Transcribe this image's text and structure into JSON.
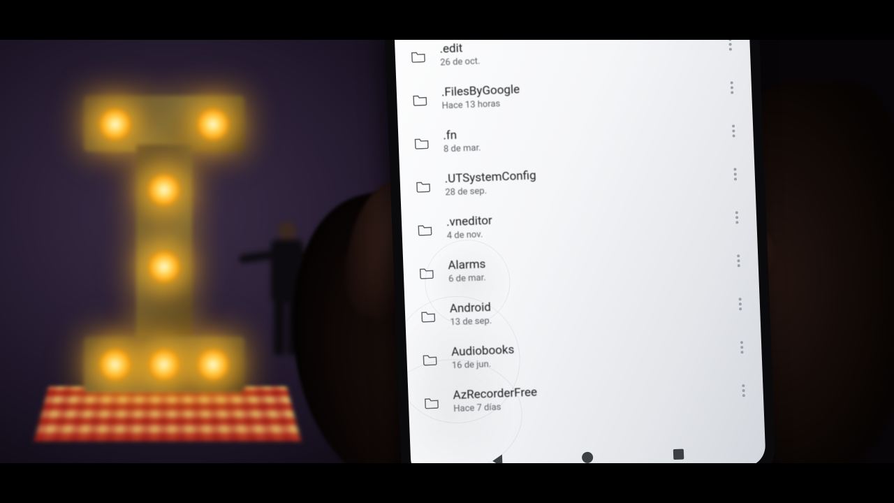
{
  "files": [
    {
      "name": ".edit",
      "date": "26 de oct."
    },
    {
      "name": ".FilesByGoogle",
      "date": "Hace 13 horas"
    },
    {
      "name": ".fn",
      "date": "8 de mar."
    },
    {
      "name": ".UTSystemConfig",
      "date": "28 de sep."
    },
    {
      "name": ".vneditor",
      "date": "4 de nov."
    },
    {
      "name": "Alarms",
      "date": "6 de mar."
    },
    {
      "name": "Android",
      "date": "13 de sep."
    },
    {
      "name": "Audiobooks",
      "date": "16 de jun."
    },
    {
      "name": "AzRecorderFree",
      "date": "Hace 7 días"
    }
  ]
}
